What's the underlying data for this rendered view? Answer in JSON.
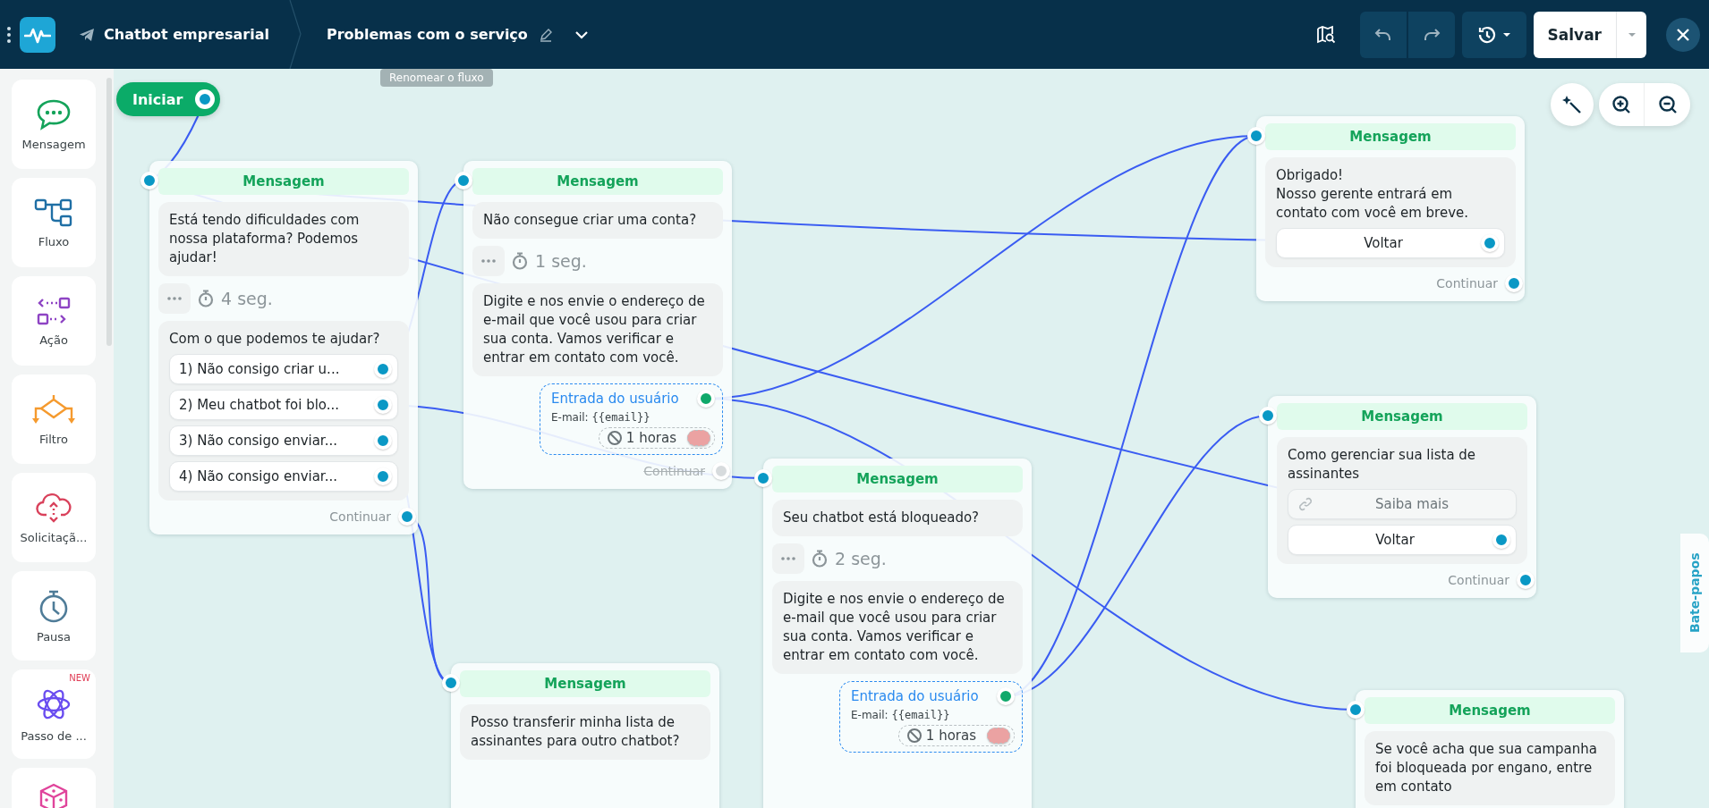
{
  "toolbar": {
    "bot_name": "Chatbot empresarial",
    "flow_name": "Problemas com o serviço",
    "tooltip": "Renomear o fluxo",
    "save_label": "Salvar"
  },
  "blocks_panel": {
    "items": [
      {
        "label": "Mensagem"
      },
      {
        "label": "Fluxo"
      },
      {
        "label": "Ação"
      },
      {
        "label": "Filtro"
      },
      {
        "label": "Solicitaçã..."
      },
      {
        "label": "Pausa"
      },
      {
        "label": "Passo de ...",
        "badge": "NEW"
      },
      {
        "kind": "icon_only"
      }
    ]
  },
  "canvas": {
    "start": {
      "label": "Iniciar"
    },
    "nodes": [
      {
        "title": "Mensagem",
        "blocks": [
          {
            "kind": "text",
            "text": "Está tendo dificuldades com nossa plataforma? Podemos ajudar!"
          },
          {
            "kind": "delay",
            "value": "4 seg."
          },
          {
            "kind": "text",
            "text": "Com o que podemos te ajudar?",
            "buttons": [
              {
                "kind": "option",
                "label": "1) Não consigo criar u..."
              },
              {
                "kind": "option",
                "label": "2) Meu chatbot foi blo..."
              },
              {
                "kind": "option",
                "label": "3) Não consigo enviar..."
              },
              {
                "kind": "option",
                "label": "4) Não consigo enviar..."
              }
            ]
          }
        ],
        "continue": {
          "label": "Continuar",
          "disabled": false
        }
      },
      {
        "title": "Mensagem",
        "blocks": [
          {
            "kind": "text",
            "text": "Não consegue criar uma conta?"
          },
          {
            "kind": "delay",
            "value": "1 seg."
          },
          {
            "kind": "text",
            "text": "Digite e nos envie o endereço de e-mail que você usou para criar sua conta. Vamos verificar e entrar em contato com você."
          },
          {
            "kind": "input",
            "title": "Entrada do usuário",
            "field_label": "E-mail:",
            "variable": "{{email}}",
            "timeout": "1 horas"
          }
        ],
        "continue": {
          "label": "Continuar",
          "disabled": true
        }
      },
      {
        "title": "Mensagem",
        "blocks": [
          {
            "kind": "text",
            "text": "Seu chatbot está bloqueado?"
          },
          {
            "kind": "delay",
            "value": "2 seg."
          },
          {
            "kind": "text",
            "text": "Digite e nos envie o endereço de e-mail que você usou para criar sua conta. Vamos verificar e entrar em contato com você."
          },
          {
            "kind": "input",
            "title": "Entrada do usuário",
            "field_label": "E-mail:",
            "variable": "{{email}}",
            "timeout": "1 horas"
          }
        ]
      },
      {
        "title": "Mensagem",
        "blocks": [
          {
            "kind": "text",
            "text": "Posso transferir minha lista de assinantes para outro chatbot?"
          }
        ]
      },
      {
        "title": "Mensagem",
        "blocks": [
          {
            "kind": "text",
            "text": "Obrigado!\nNosso gerente entrará em contato com você em breve.",
            "buttons": [
              {
                "kind": "reply",
                "label": "Voltar"
              }
            ]
          }
        ],
        "continue": {
          "label": "Continuar",
          "disabled": false
        }
      },
      {
        "title": "Mensagem",
        "blocks": [
          {
            "kind": "text",
            "text": "Como gerenciar sua lista de assinantes",
            "buttons": [
              {
                "kind": "link",
                "label": "Saiba mais"
              },
              {
                "kind": "reply",
                "label": "Voltar"
              }
            ]
          }
        ],
        "continue": {
          "label": "Continuar",
          "disabled": false
        }
      },
      {
        "title": "Mensagem",
        "blocks": [
          {
            "kind": "text",
            "text": "Se você acha que sua campanha foi bloqueada por engano, entre em contato"
          }
        ]
      }
    ]
  },
  "side_tab": {
    "label": "Bate-papos"
  }
}
